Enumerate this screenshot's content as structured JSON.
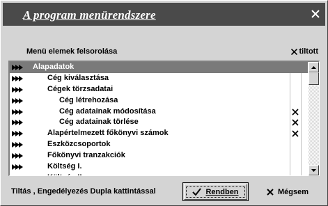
{
  "window": {
    "title": "A program menürendszere",
    "close_icon": "close-icon"
  },
  "list": {
    "label": "Menü elemek felsorolása",
    "forbidden_header": "tiltott",
    "forbidden_icon": "x-icon",
    "items": [
      {
        "label": "Alapadatok",
        "level": 0,
        "selected": true,
        "forbidden": false
      },
      {
        "label": "Cég kiválasztása",
        "level": 1,
        "selected": false,
        "forbidden": false
      },
      {
        "label": "Cégek törzsadatai",
        "level": 1,
        "selected": false,
        "forbidden": false
      },
      {
        "label": "Cég létrehozása",
        "level": 2,
        "selected": false,
        "forbidden": false
      },
      {
        "label": "Cég adatainak módosítása",
        "level": 2,
        "selected": false,
        "forbidden": true
      },
      {
        "label": "Cég adatainak törlése",
        "level": 2,
        "selected": false,
        "forbidden": true
      },
      {
        "label": "Alapértelmezett főkönyvi számok",
        "level": 1,
        "selected": false,
        "forbidden": true
      },
      {
        "label": "Eszközcsoportok",
        "level": 1,
        "selected": false,
        "forbidden": false
      },
      {
        "label": "Főkönyvi tranzakciók",
        "level": 1,
        "selected": false,
        "forbidden": false
      },
      {
        "label": "Költség I.",
        "level": 1,
        "selected": false,
        "forbidden": false
      },
      {
        "label": "Költség II.",
        "level": 1,
        "selected": false,
        "forbidden": false
      }
    ],
    "row_icon": "triple-arrow-icon"
  },
  "footer": {
    "hint": "Tiltás , Engedélyezés Dupla kattintással",
    "ok_label": "Rendben",
    "ok_icon": "checkmark-icon",
    "cancel_label": "Mégsem",
    "cancel_icon": "x-icon"
  }
}
